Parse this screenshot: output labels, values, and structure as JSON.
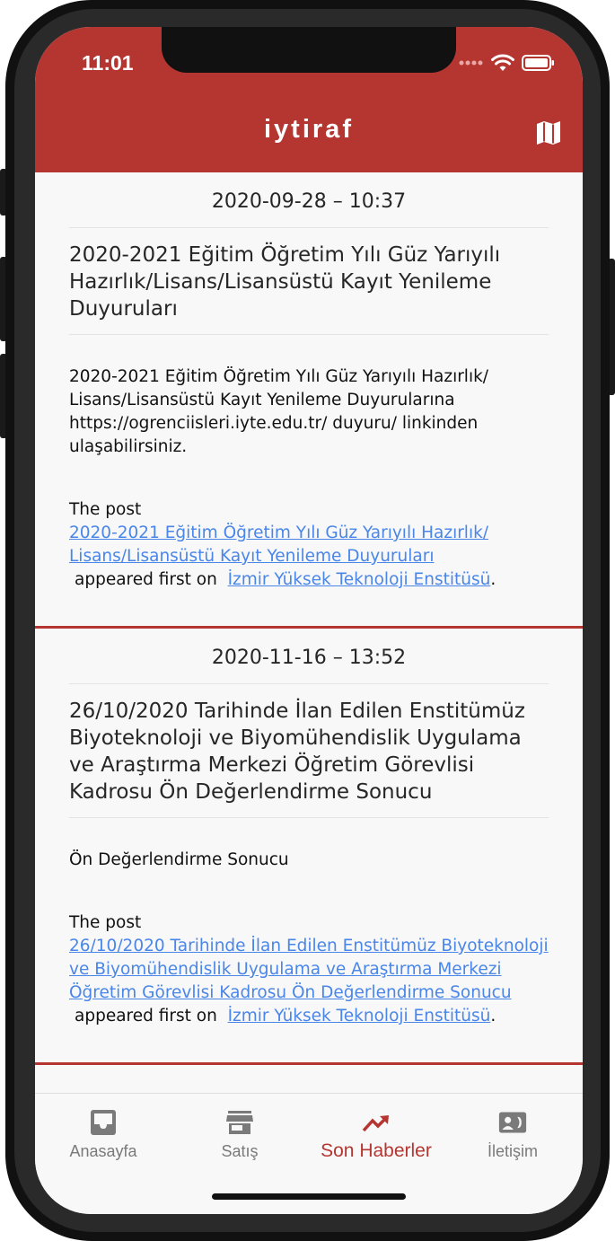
{
  "status_bar": {
    "time": "11:01"
  },
  "header": {
    "title": "iytiraf",
    "icon": "map-icon"
  },
  "posts": [
    {
      "date": "2020-09-28 – 10:37",
      "title": "2020-2021 Eğitim Öğretim Yılı Güz Yarıyılı Hazırlık/Lisans/Lisansüstü Kayıt Yenileme Duyuruları",
      "body": "2020-2021 Eğitim Öğretim Yılı Güz Yarıyılı Hazırlık/ Lisans/Lisansüstü Kayıt Yenileme Duyurularına https://ogrenciisleri.iyte.edu.tr/ duyuru/ linkinden ulaşabilirsiniz.",
      "footer_prefix": "The post",
      "footer_link": "2020-2021 Eğitim Öğretim Yılı Güz Yarıyılı Hazırlık/ Lisans/Lisansüstü Kayıt Yenileme Duyuruları",
      "footer_middle": "appeared first on",
      "footer_site": "İzmir Yüksek Teknoloji Enstitüsü",
      "footer_end": "."
    },
    {
      "date": "2020-11-16 – 13:52",
      "title": "26/10/2020 Tarihinde İlan Edilen Enstitümüz Biyoteknoloji ve Biyomühendislik Uygulama ve Araştırma Merkezi Öğretim Görevlisi Kadrosu Ön Değerlendirme Sonucu",
      "body": "Ön Değerlendirme Sonucu",
      "footer_prefix": "The post",
      "footer_link": "26/10/2020 Tarihinde İlan Edilen Enstitümüz Biyoteknoloji ve Biyomühendislik Uygulama ve Araştırma Merkezi Öğretim Görevlisi Kadrosu Ön Değerlendirme Sonucu",
      "footer_middle": "appeared first on",
      "footer_site": "İzmir Yüksek Teknoloji Enstitüsü",
      "footer_end": "."
    }
  ],
  "tabs": [
    {
      "label": "Anasayfa",
      "icon": "inbox-icon",
      "active": false
    },
    {
      "label": "Satış",
      "icon": "store-icon",
      "active": false
    },
    {
      "label": "Son Haberler",
      "icon": "trending-up-icon",
      "active": true
    },
    {
      "label": "İletişim",
      "icon": "contact-phone-icon",
      "active": false
    }
  ],
  "colors": {
    "primary": "#b53631",
    "link": "#4a86e8",
    "inactive_tab": "#7a7a7a",
    "background": "#f8f8f8"
  }
}
